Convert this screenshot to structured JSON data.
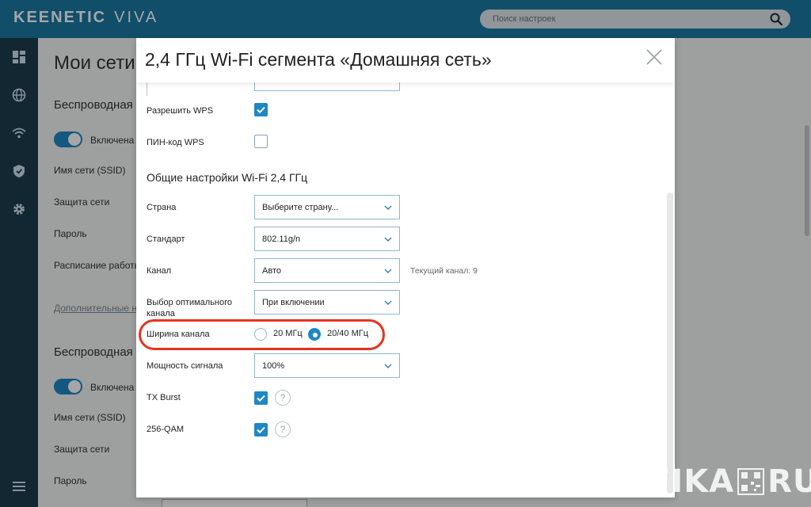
{
  "brand": {
    "name_bold": "KEENETIC",
    "name_light": "VIVA"
  },
  "search": {
    "placeholder": "Поиск настроек"
  },
  "sidebar": {
    "items": [
      "dashboard-icon",
      "globe-icon",
      "wifi-icon",
      "shield-icon",
      "gear-icon",
      "menu-icon"
    ]
  },
  "background": {
    "title": "Мои сети",
    "section1": "Беспроводная с",
    "toggle1_label": "Включена",
    "ssid_label": "Имя сети (SSID)",
    "security_label": "Защита сети",
    "password_label": "Пароль",
    "schedule_label": "Расписание работы",
    "more_link": "Дополнительные на",
    "section2": "Беспроводная с",
    "toggle2_label": "Включена",
    "ssid2_label": "Имя сети (SSID)",
    "security2_label": "Защита сети",
    "password2_label": "Пароль"
  },
  "modal": {
    "title": "2,4 ГГц Wi-Fi сегмента «Домашняя сеть»",
    "wps_label": "Разрешить WPS",
    "wps_checked": true,
    "wps_pin_label": "ПИН-код WPS",
    "wps_pin_checked": false,
    "section_title": "Общие настройки Wi-Fi 2,4 ГГц",
    "country_label": "Страна",
    "country_value": "Выберите страну...",
    "standard_label": "Стандарт",
    "standard_value": "802.11g/n",
    "channel_label": "Канал",
    "channel_value": "Авто",
    "current_channel": "Текущий канал: 9",
    "optimal_label": "Выбор оптимального канала",
    "optimal_value": "При включении",
    "width_label": "Ширина канала",
    "width_option1": "20 МГц",
    "width_option2": "20/40 МГц",
    "width_selected": "20/40 МГц",
    "power_label": "Мощность сигнала",
    "power_value": "100%",
    "txburst_label": "TX Burst",
    "txburst_checked": true,
    "qam_label": "256-QAM",
    "qam_checked": true,
    "help_symbol": "?"
  },
  "colors": {
    "accent": "#1e87c6",
    "topbar": "#1a78a4",
    "sidebar": "#1c3d4e",
    "highlight": "#e8321f"
  },
  "watermark": {
    "left": "WIFIKA",
    "right": "RU"
  }
}
